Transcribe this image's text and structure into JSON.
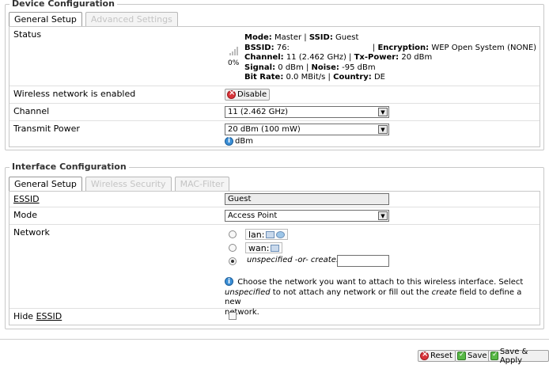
{
  "device": {
    "legend": "Device Configuration",
    "tabs": [
      "General Setup",
      "Advanced Settings"
    ],
    "status": {
      "label": "Status",
      "signal_percent": "0%",
      "mode_label": "Mode:",
      "mode_value": "Master",
      "ssid_label": "SSID:",
      "ssid_value": "Guest",
      "bssid_label": "BSSID:",
      "bssid_value": "76:",
      "encryption_label": "Encryption:",
      "encryption_value": "WEP Open System (NONE)",
      "channel_label": "Channel:",
      "channel_value": "11 (2.462 GHz)",
      "txpower_label": "Tx-Power:",
      "txpower_value": "20 dBm",
      "signal_label": "Signal:",
      "signal_value": "0 dBm",
      "noise_label": "Noise:",
      "noise_value": "-95 dBm",
      "bitrate_label": "Bit Rate:",
      "bitrate_value": "0.0 MBit/s",
      "country_label": "Country:",
      "country_value": "DE"
    },
    "wireless_enabled": {
      "label": "Wireless network is enabled",
      "button": "Disable"
    },
    "channel": {
      "label": "Channel",
      "value": "11 (2.462 GHz)"
    },
    "transmit_power": {
      "label": "Transmit Power",
      "value": "20 dBm (100 mW)",
      "hint": "dBm"
    }
  },
  "interface": {
    "legend": "Interface Configuration",
    "tabs": [
      "General Setup",
      "Wireless Security",
      "MAC-Filter"
    ],
    "essid": {
      "label": "ESSID",
      "value": "Guest"
    },
    "mode": {
      "label": "Mode",
      "value": "Access Point"
    },
    "network": {
      "label": "Network",
      "lan": "lan:",
      "wan": "wan:",
      "unspecified": "unspecified -or- create:",
      "create_value": "",
      "help_1": "Choose the network you want to attach to this wireless interface. Select",
      "help_2a": "unspecified",
      "help_2b": " to not attach any network or fill out the ",
      "help_2c": "create",
      "help_2d": " field to define a new",
      "help_3": "network."
    },
    "hide_essid": {
      "label": "Hide ESSID"
    }
  },
  "footer": {
    "reset": "Reset",
    "save": "Save",
    "save_apply": "Save & Apply"
  }
}
